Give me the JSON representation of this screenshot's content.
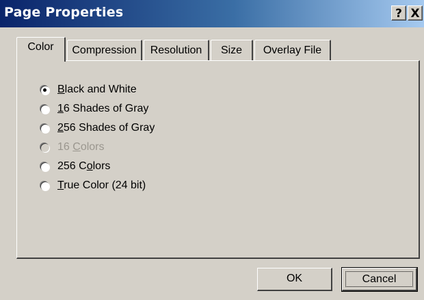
{
  "window": {
    "title": "Page Properties",
    "help_glyph": "?",
    "close_glyph": "X"
  },
  "tabs": {
    "color": "Color",
    "compression": "Compression",
    "resolution": "Resolution",
    "size": "Size",
    "overlay": "Overlay File",
    "active": "Color"
  },
  "color_options": [
    {
      "accel": "B",
      "rest": "lack and White",
      "checked": true,
      "enabled": true
    },
    {
      "accel": "1",
      "rest": "6 Shades of Gray",
      "checked": false,
      "enabled": true
    },
    {
      "accel": "2",
      "rest": "56 Shades of Gray",
      "checked": false,
      "enabled": true
    },
    {
      "pre": "16 ",
      "accel": "C",
      "rest": "olors",
      "checked": false,
      "enabled": false
    },
    {
      "pre": "256 C",
      "accel": "o",
      "rest": "lors",
      "checked": false,
      "enabled": true
    },
    {
      "accel": "T",
      "rest": "rue Color (24 bit)",
      "checked": false,
      "enabled": true
    }
  ],
  "buttons": {
    "ok": "OK",
    "cancel": "Cancel"
  },
  "colors": {
    "title_start": "#0a246a",
    "title_end": "#a6caf0",
    "face": "#d4d0c8",
    "disabled_text": "#9a968e"
  }
}
